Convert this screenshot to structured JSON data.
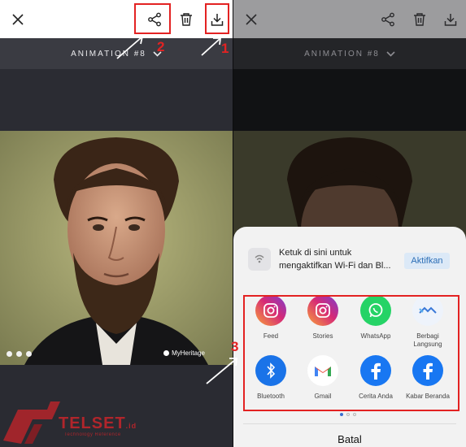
{
  "toolbar": {
    "close_icon": "close-icon",
    "share_icon": "share-icon",
    "delete_icon": "trash-icon",
    "download_icon": "download-icon"
  },
  "animation_label": "ANIMATION #8",
  "photo_watermark": "MyHeritage",
  "share_sheet": {
    "wifi_prompt": "Ketuk di sini untuk mengaktifkan Wi-Fi dan Bl...",
    "wifi_button": "Aktifkan",
    "apps": [
      {
        "label": "Feed",
        "icon": "instagram-icon"
      },
      {
        "label": "Stories",
        "icon": "instagram-icon"
      },
      {
        "label": "WhatsApp",
        "icon": "whatsapp-icon"
      },
      {
        "label": "Berbagi Langsung",
        "icon": "nearby-share-icon"
      },
      {
        "label": "Bluetooth",
        "icon": "bluetooth-icon"
      },
      {
        "label": "Gmail",
        "icon": "gmail-icon"
      },
      {
        "label": "Cerita Anda",
        "icon": "facebook-icon"
      },
      {
        "label": "Kabar Beranda",
        "icon": "facebook-icon"
      }
    ],
    "cancel_label": "Batal"
  },
  "annotations": [
    "1",
    "2",
    "3"
  ],
  "logo": {
    "text": "TELSET",
    "suffix": ".id",
    "tagline": "Technology Reference"
  },
  "colors": {
    "annotation_red": "#e32222",
    "instagram": "#d62976",
    "whatsapp": "#25d366",
    "facebook": "#1877f2",
    "bluetooth": "#1a73e8"
  }
}
